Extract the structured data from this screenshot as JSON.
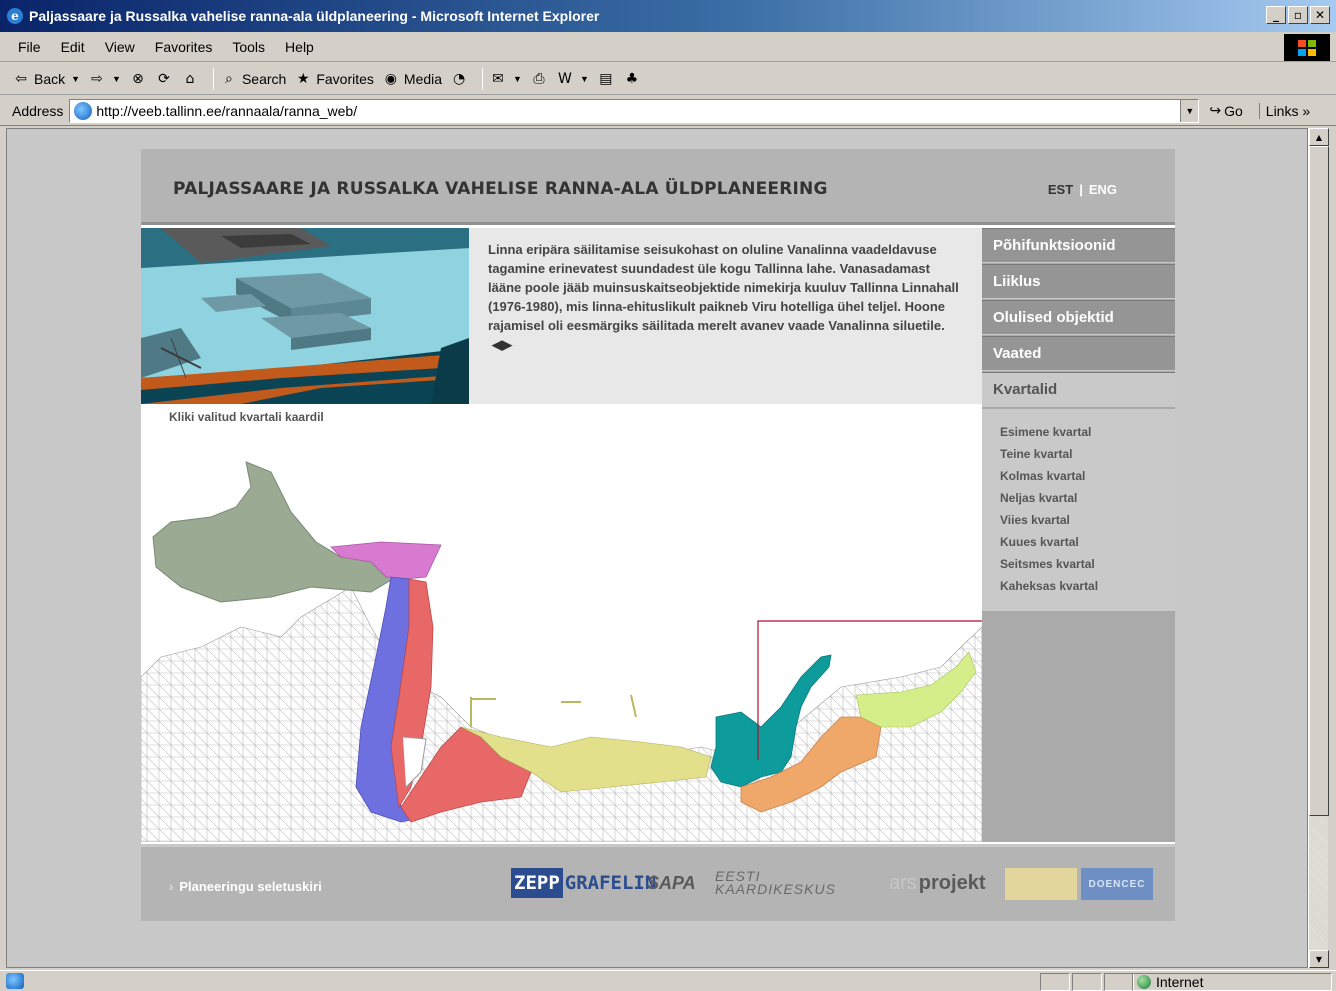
{
  "window": {
    "title": "Paljassaare ja Russalka vahelise ranna-ala üldplaneering - Microsoft Internet Explorer",
    "controls": [
      "_",
      "▫",
      "✕"
    ]
  },
  "menu": [
    "File",
    "Edit",
    "View",
    "Favorites",
    "Tools",
    "Help"
  ],
  "toolbar": {
    "back": "Back",
    "search": "Search",
    "favorites": "Favorites",
    "media": "Media"
  },
  "address": {
    "label": "Address",
    "url": "http://veeb.tallinn.ee/rannaala/ranna_web/",
    "go": "Go",
    "links": "Links"
  },
  "page": {
    "title": "PALJASSAARE JA RUSSALKA VAHELISE RANNA-ALA ÜLDPLANEERING",
    "lang_est": "EST",
    "lang_sep": "|",
    "lang_eng": "ENG",
    "intro": "Linna eripära säilitamise seisukohast on oluline Vanalinna vaadeldavuse tagamine erinevatest suundadest üle kogu Tallinna lahe. Vanasadamast lääne poole jääb muinsuskaitseobjektide nimekirja kuuluv Tallinna Linnahall (1976-1980), mis linna-ehituslikult paikneb Viru hotelliga ühel teljel. Hoone rajamisel oli eesmärgiks säilitada merelt avanev vaade Vanalinna siluetile.",
    "intro_arrows": "◀▶",
    "map_caption": "Kliki valitud kvartali kaardil",
    "nav": [
      {
        "label": "Põhifunktsioonid",
        "active": false
      },
      {
        "label": "Liiklus",
        "active": false
      },
      {
        "label": "Olulised objektid",
        "active": false
      },
      {
        "label": "Vaated",
        "active": false
      },
      {
        "label": "Kvartalid",
        "active": true
      }
    ],
    "subnav": [
      "Esimene kvartal",
      "Teine kvartal",
      "Kolmas kvartal",
      "Neljas kvartal",
      "Viies kvartal",
      "Kuues kvartal",
      "Seitsmes kvartal",
      "Kaheksas kvartal"
    ],
    "footer_link": "Planeeringu seletuskiri",
    "logos": {
      "zepp": "ZEPP",
      "grafelin": "GRAFELIN",
      "sapa": "SAPA",
      "eesti": "EESTI",
      "kaardikeskus": "KAARDIKESKUS",
      "ars": "ars",
      "projekt": "projekt",
      "blue": "DOENCEC"
    },
    "map_colors": {
      "green": "#9aaa93",
      "magenta": "#d97ad1",
      "blue": "#6f70e0",
      "red": "#e86868",
      "yellow": "#e2e08a",
      "teal": "#0e9b9b",
      "orange": "#f0a86a",
      "lime": "#d6ee8a"
    }
  },
  "status": {
    "zone": "Internet"
  }
}
